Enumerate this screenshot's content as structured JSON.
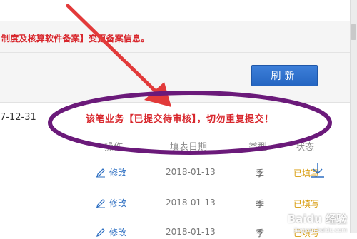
{
  "notice": "制度及核算软件备案】变更备案信息。",
  "refresh_label": "刷新",
  "date_label": "7-12-31",
  "warning": "该笔业务【已提交待审核】，切勿重复提交！",
  "columns": [
    "操作",
    "填表日期",
    "类型",
    "状态"
  ],
  "rows": [
    {
      "action": "修改",
      "date": "2018-01-13",
      "type": "季",
      "status": "已填写"
    },
    {
      "action": "修改",
      "date": "2018-01-13",
      "type": "季",
      "status": "已填写"
    },
    {
      "action": "修改",
      "date": "2018-01-13",
      "type": "季",
      "status": "已填写"
    }
  ],
  "watermark": "Baidu 经验",
  "watermark_url": "jingyan.baidu.com",
  "colors": {
    "alert_red": "#d8262c",
    "link_blue": "#2e6fc2",
    "status_orange": "#d89b0a",
    "annotation_red": "#e23a3a",
    "annotation_purple": "#6b1a7a"
  }
}
